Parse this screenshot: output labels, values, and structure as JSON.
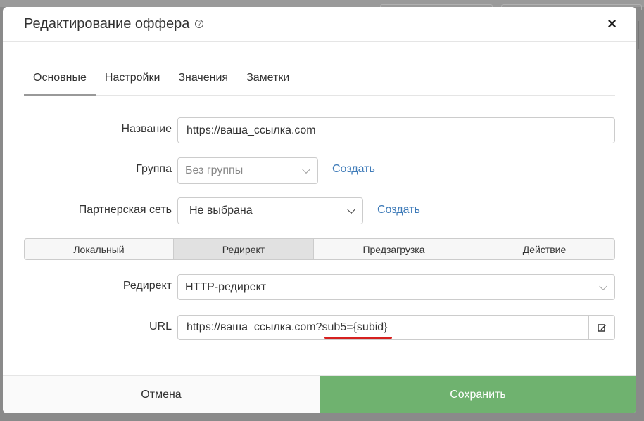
{
  "modal": {
    "title": "Редактирование оффера",
    "help_glyph": "?",
    "close_glyph": "×"
  },
  "tabs": [
    {
      "label": "Основные",
      "active": true
    },
    {
      "label": "Настройки",
      "active": false
    },
    {
      "label": "Значения",
      "active": false
    },
    {
      "label": "Заметки",
      "active": false
    }
  ],
  "form": {
    "name": {
      "label": "Название",
      "value": "https://ваша_ссылка.com"
    },
    "group": {
      "label": "Группа",
      "value": "Без группы",
      "create_link": "Создать"
    },
    "network": {
      "label": "Партнерская сеть",
      "value": "Не выбрана",
      "create_link": "Создать"
    },
    "redirect": {
      "label": "Редирект",
      "value": "HTTP-редирект"
    },
    "url": {
      "label": "URL",
      "value": "https://ваша_ссылка.com?sub5={subid}"
    }
  },
  "type_segments": [
    {
      "label": "Локальный",
      "active": false
    },
    {
      "label": "Редирект",
      "active": true
    },
    {
      "label": "Предзагрузка",
      "active": false
    },
    {
      "label": "Действие",
      "active": false
    }
  ],
  "footer": {
    "cancel_label": "Отмена",
    "save_label": "Сохранить"
  },
  "colors": {
    "accent_link": "#3d7ab8",
    "save_button": "#6fb26f",
    "annotation_underline": "#d6201f"
  },
  "icons": {
    "help": "help-circle-icon",
    "close": "close-icon",
    "edit": "edit-pencil-icon",
    "dropdown": "chevron-down-icon"
  }
}
